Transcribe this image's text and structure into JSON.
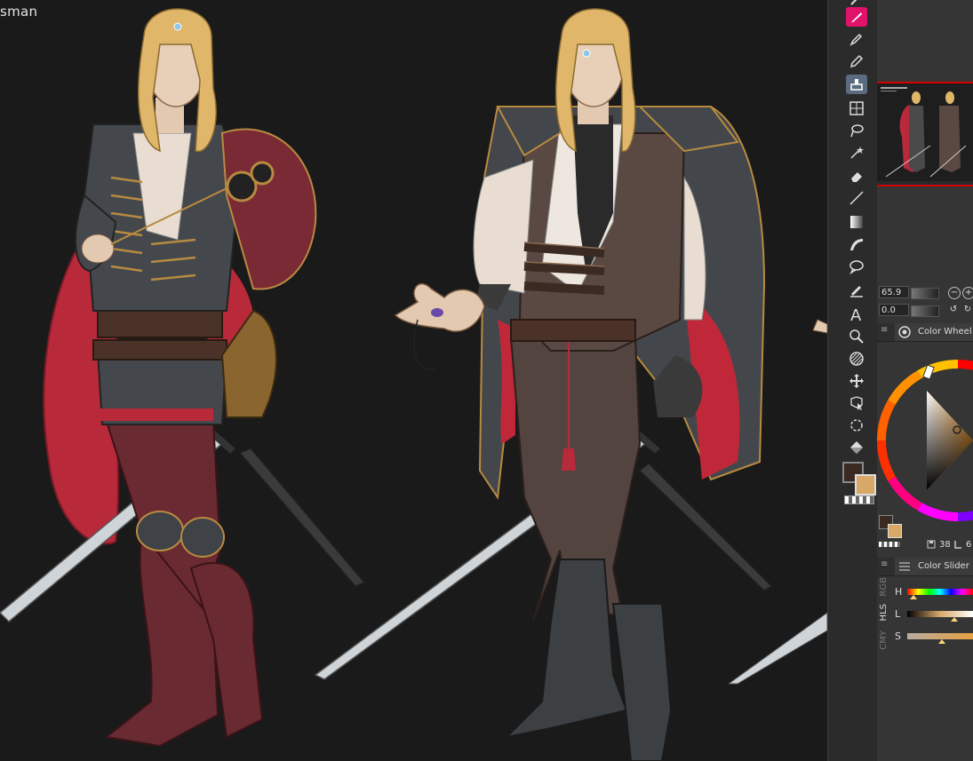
{
  "canvas": {
    "title_fragment": "sman"
  },
  "toolbar": {
    "tools": [
      {
        "name": "brush-pink-icon"
      },
      {
        "name": "pen-icon"
      },
      {
        "name": "pencil-icon"
      },
      {
        "name": "stamp-icon"
      },
      {
        "name": "frame-icon"
      },
      {
        "name": "lasso-icon"
      },
      {
        "name": "magic-wand-icon"
      },
      {
        "name": "eraser-icon"
      },
      {
        "name": "line-icon"
      },
      {
        "name": "gradient-icon"
      },
      {
        "name": "curve-icon"
      },
      {
        "name": "balloon-icon"
      },
      {
        "name": "ruler-pen-icon"
      },
      {
        "name": "text-icon"
      },
      {
        "name": "zoom-icon"
      },
      {
        "name": "pattern-icon"
      },
      {
        "name": "move-icon"
      },
      {
        "name": "object-select-icon"
      },
      {
        "name": "rotate-icon"
      },
      {
        "name": "fill-icon"
      }
    ],
    "colors": {
      "main": "#3a2a22",
      "sub": "#d8a868",
      "accent": "#e0126a"
    }
  },
  "navigator": {
    "zoom_value": "65.9",
    "rotate_value": "0.0"
  },
  "color_wheel_panel": {
    "label": "Color Wheel"
  },
  "color_info": {
    "value_1": "38",
    "value_2": "6"
  },
  "color_slider_panel": {
    "label": "Color Slider",
    "side_tabs": [
      "RGB",
      "HLS",
      "CMY"
    ],
    "sliders": [
      {
        "label": "H",
        "value": 0.1
      },
      {
        "label": "L",
        "value": 0.72
      },
      {
        "label": "S",
        "value": 0.53
      }
    ]
  }
}
